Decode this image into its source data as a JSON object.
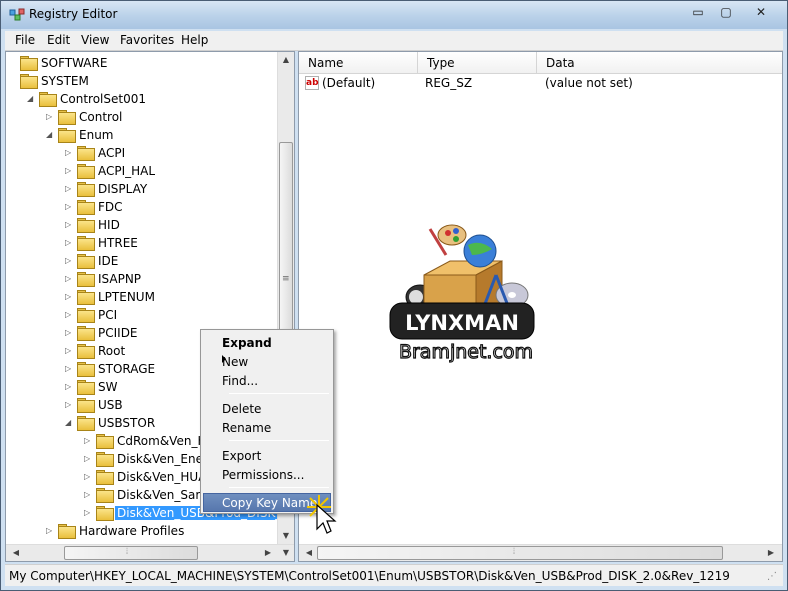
{
  "window": {
    "title": "Registry Editor",
    "controls": {
      "minimize": "▭",
      "maximize": "▢",
      "close": "✕"
    }
  },
  "menubar": [
    "File",
    "Edit",
    "View",
    "Favorites",
    "Help"
  ],
  "tree": [
    {
      "label": "SOFTWARE",
      "depth": 0,
      "expander": ""
    },
    {
      "label": "SYSTEM",
      "depth": 0,
      "expander": ""
    },
    {
      "label": "ControlSet001",
      "depth": 1,
      "expander": "◢"
    },
    {
      "label": "Control",
      "depth": 2,
      "expander": "▷"
    },
    {
      "label": "Enum",
      "depth": 2,
      "expander": "◢"
    },
    {
      "label": "ACPI",
      "depth": 3,
      "expander": "▷"
    },
    {
      "label": "ACPI_HAL",
      "depth": 3,
      "expander": "▷"
    },
    {
      "label": "DISPLAY",
      "depth": 3,
      "expander": "▷"
    },
    {
      "label": "FDC",
      "depth": 3,
      "expander": "▷"
    },
    {
      "label": "HID",
      "depth": 3,
      "expander": "▷"
    },
    {
      "label": "HTREE",
      "depth": 3,
      "expander": "▷"
    },
    {
      "label": "IDE",
      "depth": 3,
      "expander": "▷"
    },
    {
      "label": "ISAPNP",
      "depth": 3,
      "expander": "▷"
    },
    {
      "label": "LPTENUM",
      "depth": 3,
      "expander": "▷"
    },
    {
      "label": "PCI",
      "depth": 3,
      "expander": "▷"
    },
    {
      "label": "PCIIDE",
      "depth": 3,
      "expander": "▷"
    },
    {
      "label": "Root",
      "depth": 3,
      "expander": "▷"
    },
    {
      "label": "STORAGE",
      "depth": 3,
      "expander": "▷"
    },
    {
      "label": "SW",
      "depth": 3,
      "expander": "▷"
    },
    {
      "label": "USB",
      "depth": 3,
      "expander": "▷"
    },
    {
      "label": "USBSTOR",
      "depth": 3,
      "expander": "◢"
    },
    {
      "label": "CdRom&Ven_HUA",
      "depth": 4,
      "expander": "▷"
    },
    {
      "label": "Disk&Ven_Energy2",
      "depth": 4,
      "expander": "▷"
    },
    {
      "label": "Disk&Ven_HUAWEI",
      "depth": 4,
      "expander": "▷"
    },
    {
      "label": "Disk&Ven_Samsung",
      "depth": 4,
      "expander": "▷"
    },
    {
      "label": "Disk&Ven_USB&Prod_DISK_2.0",
      "depth": 4,
      "expander": "▷",
      "selected": true
    },
    {
      "label": "Hardware Profiles",
      "depth": 2,
      "expander": "▷"
    }
  ],
  "list": {
    "columns": [
      "Name",
      "Type",
      "Data"
    ],
    "rows": [
      {
        "name": "(Default)",
        "type": "REG_SZ",
        "data": "(value not set)",
        "icon": "string-value-icon"
      }
    ]
  },
  "watermark": {
    "brand": "LYNXMAN",
    "site": "Bramjnet.com"
  },
  "context_menu": {
    "items": [
      {
        "label": "Expand",
        "bold": true
      },
      {
        "label": "New",
        "submenu": true
      },
      {
        "label": "Find..."
      },
      {
        "sep": true
      },
      {
        "label": "Delete"
      },
      {
        "label": "Rename"
      },
      {
        "sep": true
      },
      {
        "label": "Export"
      },
      {
        "label": "Permissions..."
      },
      {
        "sep": true
      },
      {
        "label": "Copy Key Name",
        "highlighted": true
      }
    ]
  },
  "status": {
    "path": "My Computer\\HKEY_LOCAL_MACHINE\\SYSTEM\\ControlSet001\\Enum\\USBSTOR\\Disk&Ven_USB&Prod_DISK_2.0&Rev_1219"
  }
}
